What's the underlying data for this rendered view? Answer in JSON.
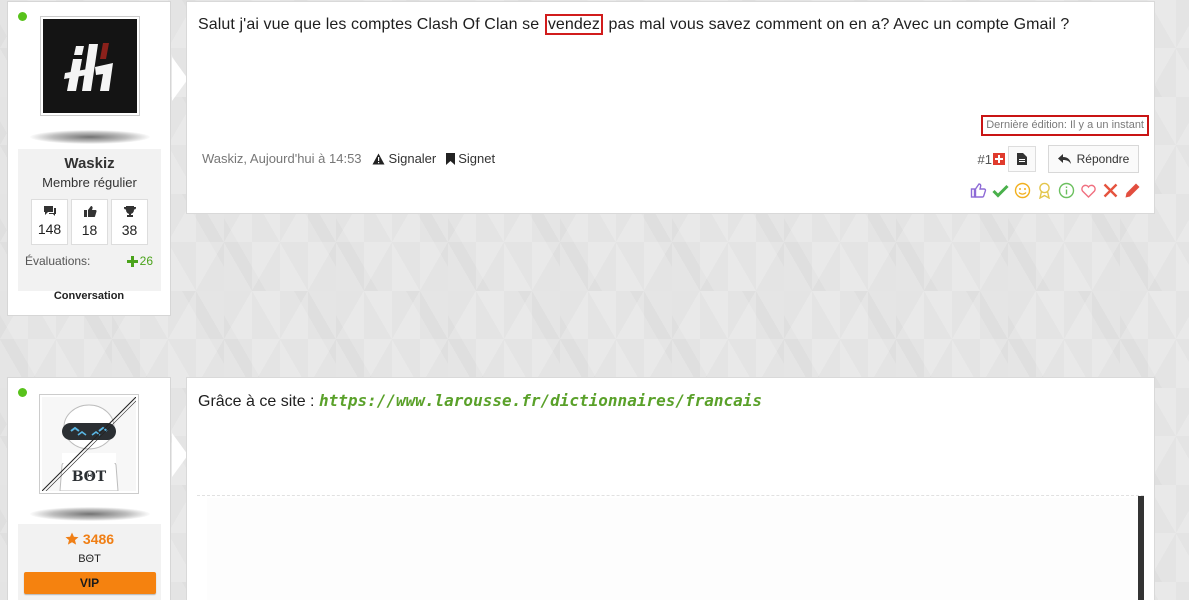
{
  "post1": {
    "user": {
      "name": "Waskiz",
      "title": "Membre régulier",
      "stats": [
        {
          "icon": "comments-icon",
          "value": "148"
        },
        {
          "icon": "thumbs-up-icon",
          "value": "18"
        },
        {
          "icon": "trophy-icon",
          "value": "38"
        }
      ],
      "rating_label": "Évaluations:",
      "rating_value": "26",
      "conversation_label": "Conversation"
    },
    "message_before": "Salut j'ai vue que les comptes Clash Of Clan se ",
    "message_highlight": "vendez",
    "message_after": " pas mal vous savez comment on en a? Avec un compte Gmail ?",
    "last_edit": "Dernière édition: Il y a un instant",
    "meta_author_time": "Waskiz, Aujourd'hui à 14:53",
    "report_label": "Signaler",
    "bookmark_label": "Signet",
    "post_number": "#1",
    "reply_label": "Répondre"
  },
  "post2": {
    "user": {
      "score": "3486",
      "title": "BΘT",
      "vip_label": "VIP",
      "avatar_text": "BΘT"
    },
    "message_prefix": "Grâce à ce site : ",
    "link": "https://www.larousse.fr/dictionnaires/francais"
  },
  "colors": {
    "online": "#58c21b",
    "highlight_border": "#d11c1c",
    "rating_green": "#4aa31b",
    "score_orange": "#f07f15",
    "vip_orange": "#f5820f",
    "link_green": "#5aa12a"
  }
}
